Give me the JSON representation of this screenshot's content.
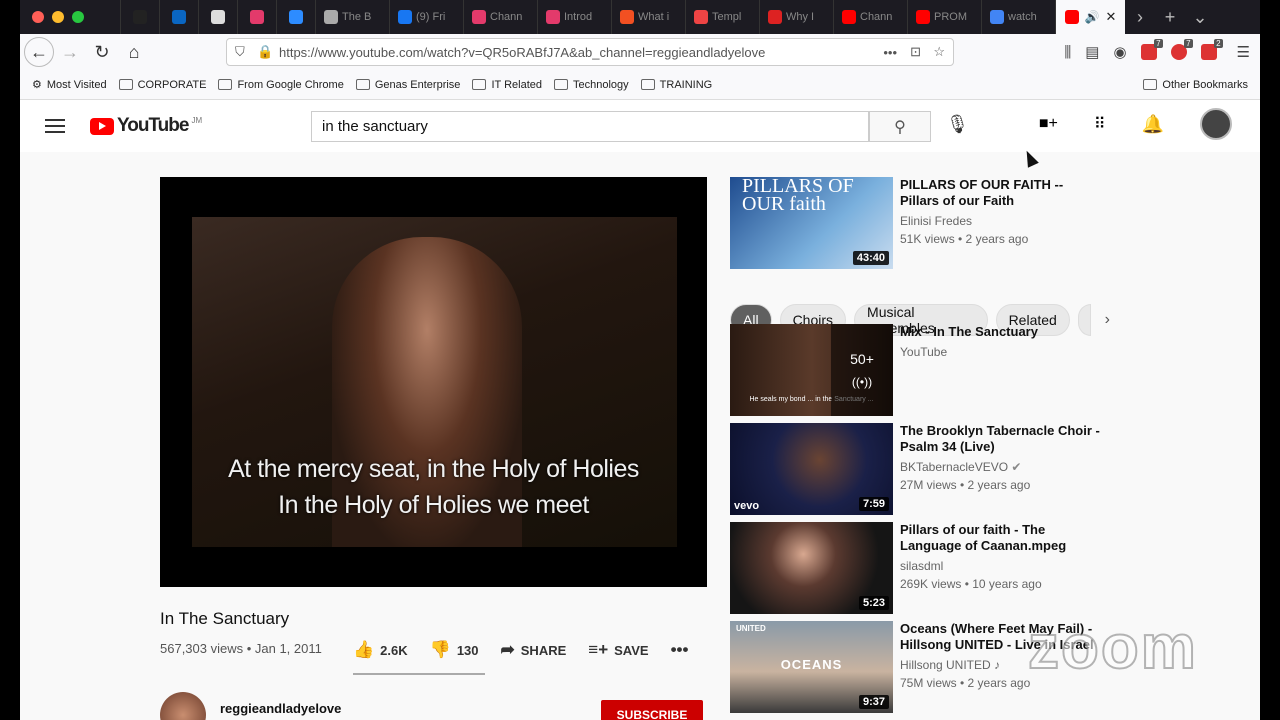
{
  "browser": {
    "tabs": [
      {
        "label": "",
        "icon": "cross-icon",
        "color": "#222"
      },
      {
        "label": "",
        "icon": "linkedin-icon",
        "color": "#0a66c2"
      },
      {
        "label": "",
        "icon": "screen-icon",
        "color": "#ddd"
      },
      {
        "label": "",
        "icon": "brush-icon",
        "color": "#e33a6b"
      },
      {
        "label": "",
        "icon": "zoom-icon",
        "color": "#2d8cff"
      },
      {
        "label": "The B",
        "icon": "chevron-left-icon",
        "color": "#aaa"
      },
      {
        "label": "(9) Fri",
        "icon": "facebook-icon",
        "color": "#1877f2"
      },
      {
        "label": "Chann",
        "icon": "record-icon",
        "color": "#e33a6b"
      },
      {
        "label": "Introd",
        "icon": "record-icon",
        "color": "#e33a6b"
      },
      {
        "label": "What i",
        "icon": "microsoft-icon",
        "color": "#f25022"
      },
      {
        "label": "Templ",
        "icon": "template-icon",
        "color": "#e44"
      },
      {
        "label": "Why I",
        "icon": "bars-icon",
        "color": "#d22"
      },
      {
        "label": "Chann",
        "icon": "youtube-icon",
        "color": "#f00"
      },
      {
        "label": "PROM",
        "icon": "youtube-icon",
        "color": "#f00"
      },
      {
        "label": "watch",
        "icon": "google-icon",
        "color": "#4285f4"
      }
    ],
    "url": "https://www.youtube.com/watch?v=QR5oRABfJ7A&ab_channel=reggieandladyelove",
    "ext_badges": [
      "7",
      "7",
      "2"
    ],
    "bookmarks": [
      "Most Visited",
      "CORPORATE",
      "From Google Chrome",
      "Genas Enterprise",
      "IT Related",
      "Technology",
      "TRAINING"
    ],
    "other_bookmarks": "Other Bookmarks"
  },
  "youtube": {
    "logo_text": "YouTube",
    "region": "JM",
    "search_value": "in the sanctuary",
    "video": {
      "lyric_line1": "At the mercy seat, in the Holy of Holies",
      "lyric_line2": "In the Holy of Holies we meet",
      "title": "In The Sanctuary",
      "meta": "567,303 views • Jan 1, 2011",
      "likes": "2.6K",
      "dislikes": "130",
      "share": "SHARE",
      "save": "SAVE",
      "channel": "reggieandladyelove",
      "subscribe": "SUBSCRIBE"
    },
    "chips": [
      "All",
      "Choirs",
      "Musical ensembles",
      "Related"
    ],
    "top_item": {
      "title": "PILLARS OF OUR FAITH -- Pillars of our Faith",
      "channel": "Elinisi Fredes",
      "meta": "51K views • 2 years ago",
      "duration": "43:40",
      "thumb_text": "PILLARS OF OUR faith"
    },
    "items": [
      {
        "title": "Mix - In The Sanctuary",
        "channel": "YouTube",
        "meta": "",
        "duration": "50+",
        "thumb_caption": "He seals my bond ... in the Sanctuary ..."
      },
      {
        "title": "The Brooklyn Tabernacle Choir - Psalm 34 (Live)",
        "channel": "BKTabernacleVEVO",
        "meta": "27M views • 2 years ago",
        "duration": "7:59",
        "thumb_caption": "vevo"
      },
      {
        "title": "Pillars of our faith - The Language of Caanan.mpeg",
        "channel": "silasdml",
        "meta": "269K views • 10 years ago",
        "duration": "5:23",
        "thumb_caption": ""
      },
      {
        "title": "Oceans (Where Feet May Fail) - Hillsong UNITED - Live in Israel",
        "channel": "Hillsong UNITED",
        "meta": "75M views • 2 years ago",
        "duration": "9:37",
        "thumb_caption": "OCEANS"
      }
    ]
  },
  "overlay": {
    "watermark": "zoom"
  },
  "colors": {
    "youtube_red": "#ff0000",
    "subscribe_red": "#cc0000",
    "chip_active": "#606060"
  }
}
